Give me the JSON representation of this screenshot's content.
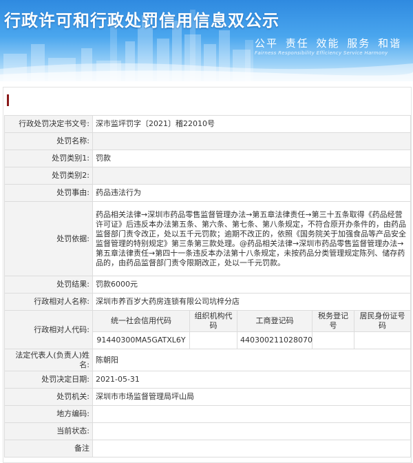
{
  "header": {
    "title": "行政许可和行政处罚信用信息双公示",
    "slogan": "公平 责任 效能 服务 和谐",
    "slogan_en": "Fairness Responsibility Efficiency Service Harmony"
  },
  "colors": {
    "banner": "#3d98e8",
    "marker": "#8a1a1a",
    "label_bg": "#f3f3f3",
    "border": "#dcdcdc"
  },
  "record": {
    "doc_no": {
      "label": "行政处罚决定书文号:",
      "value": "深市监坪罚字〔2021〕稽22010号"
    },
    "name": {
      "label": "处罚名称:",
      "value": ""
    },
    "type1": {
      "label": "处罚类别1:",
      "value": "罚款"
    },
    "type2": {
      "label": "处罚类别2:",
      "value": ""
    },
    "cause": {
      "label": "处罚事由:",
      "value": "药品违法行为"
    },
    "basis": {
      "label": "处罚依据:",
      "value": "药品相关法律→深圳市药品零售监督管理办法→第五章法律责任→第三十五条取得《药品经营许可证》后违反本办法第五条、第六条、第七条、第八条规定，不符合原开办条件的，由药品监督部门责令改正，处以五千元罚款；逾期不改正的，依照《国务院关于加强食品等产品安全监督管理的特别规定》第三条第三款处理。@药品相关法律→深圳市药品零售监督管理办法→第五章法律责任→第四十一条违反本办法第十八条规定，未按药品分类管理规定陈列、储存药品的，由药品监督部门责令限期改正，处以一千元罚款。"
    },
    "result": {
      "label": "处罚结果:",
      "value": "罚款6000元"
    },
    "party": {
      "label": "行政相对人名称:",
      "value": "深圳市养百岁大药房连锁有限公司坑梓分店"
    },
    "codes": {
      "label": "行政相对人代码:",
      "headers": [
        "统一社会信用代码",
        "组织机构代码",
        "工商登记码",
        "税务登记号",
        "居民身份证号码"
      ],
      "values": [
        "91440300MA5GATXL6Y",
        "",
        "440300211028070",
        "",
        ""
      ]
    },
    "legal_rep": {
      "label": "法定代表人(负责人)姓名:",
      "value": "陈朝阳"
    },
    "date": {
      "label": "处罚决定日期:",
      "value": "2021-05-31"
    },
    "authority": {
      "label": "处罚机关:",
      "value": "深圳市市场监督管理局坪山局"
    },
    "area_code": {
      "label": "地方编码:",
      "value": ""
    },
    "status": {
      "label": "当前状态:",
      "value": ""
    },
    "remark": {
      "label": "备注",
      "value": ""
    }
  }
}
